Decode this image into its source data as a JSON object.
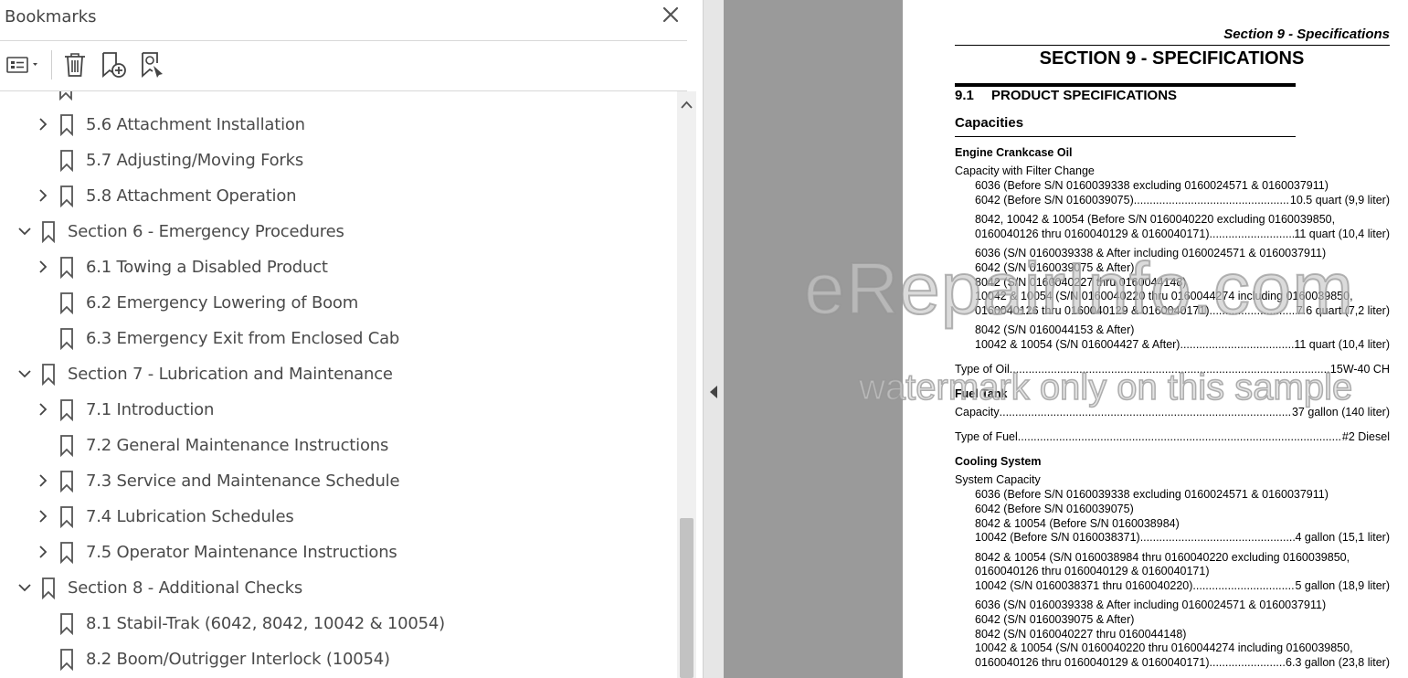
{
  "panel": {
    "title": "Bookmarks",
    "close_icon": "close-icon",
    "toolbar": [
      "options-menu-icon",
      "delete-bookmark-icon",
      "new-bookmark-icon",
      "find-current-bookmark-icon"
    ]
  },
  "bookmarks": [
    {
      "level": 1,
      "label": "5.6 Attachment Installation",
      "expandable": true
    },
    {
      "level": 1,
      "label": "5.7 Adjusting/Moving Forks",
      "expandable": false
    },
    {
      "level": 1,
      "label": "5.8 Attachment Operation",
      "expandable": true
    },
    {
      "level": 0,
      "label": "Section 6 - Emergency Procedures",
      "expandable": true,
      "expanded": true
    },
    {
      "level": 1,
      "label": "6.1 Towing a Disabled Product",
      "expandable": true
    },
    {
      "level": 1,
      "label": "6.2 Emergency Lowering of Boom",
      "expandable": false
    },
    {
      "level": 1,
      "label": "6.3 Emergency Exit from Enclosed Cab",
      "expandable": false
    },
    {
      "level": 0,
      "label": "Section 7 - Lubrication and Maintenance",
      "expandable": true,
      "expanded": true
    },
    {
      "level": 1,
      "label": "7.1 Introduction",
      "expandable": true
    },
    {
      "level": 1,
      "label": "7.2 General Maintenance Instructions",
      "expandable": false
    },
    {
      "level": 1,
      "label": "7.3 Service and Maintenance Schedule",
      "expandable": true
    },
    {
      "level": 1,
      "label": "7.4 Lubrication Schedules",
      "expandable": true
    },
    {
      "level": 1,
      "label": "7.5 Operator Maintenance Instructions",
      "expandable": true
    },
    {
      "level": 0,
      "label": "Section 8 - Additional Checks",
      "expandable": true,
      "expanded": true
    },
    {
      "level": 1,
      "label": "8.1 Stabil-Trak (6042, 8042, 10042 & 10054)",
      "expandable": false
    },
    {
      "level": 1,
      "label": "8.2 Boom/Outrigger Interlock (10054)",
      "expandable": false
    }
  ],
  "page": {
    "header": "Section 9 - Specifications",
    "section_title": "SECTION 9 - SPECIFICATIONS",
    "sub_num": "9.1",
    "sub_title": "PRODUCT SPECIFICATIONS",
    "capacities": "Capacities",
    "engine_oil": "Engine Crankcase Oil",
    "cap_filter": "Capacity with Filter Change",
    "eo1a": "6036 (Before S/N 0160039338 excluding 0160024571 & 0160037911)",
    "eo1b": "6042 (Before S/N 0160039075)",
    "eo1b_val": "10.5 quart (9,9 liter)",
    "eo2a": "8042, 10042 & 10054 (Before S/N 0160040220 excluding 0160039850,",
    "eo2b": "0160040126 thru 0160040129 & 0160040171)",
    "eo2b_val": "11 quart (10,4 liter)",
    "eo3a": "6036 (S/N 0160039338 & After including 0160024571 & 0160037911)",
    "eo3b": "6042 (S/N 0160039075 & After)",
    "eo3c": "8042 (S/N 0160040227 thru 0160044148)",
    "eo3d": "10042  &  10054  (S/N  0160040220  thru  0160044274  including  0160039850,",
    "eo3e": "0160040126 thru 0160040129 & 0160040171)",
    "eo3e_val": "7.6 quart (7,2 liter)",
    "eo4a": "8042 (S/N 0160044153 & After)",
    "eo4b": "10042 & 10054 (S/N 016004427 & After)",
    "eo4b_val": "11 quart (10,4 liter)",
    "oil_type": "Type of Oil",
    "oil_type_val": "15W-40 CH",
    "fuel_tank": "Fuel Tank",
    "fuel_cap": "Capacity",
    "fuel_cap_val": "37 gallon (140 liter)",
    "fuel_type": "Type of Fuel",
    "fuel_type_val": "#2 Diesel",
    "cooling": "Cooling System",
    "sys_cap": "System Capacity",
    "cs1a": "6036 (Before S/N 0160039338 excluding 0160024571 & 0160037911)",
    "cs1b": "6042 (Before S/N 0160039075)",
    "cs1c": "8042 & 10054 (Before S/N 0160038984)",
    "cs1d": "10042 (Before S/N 0160038371)",
    "cs1d_val": "4 gallon (15,1 liter)",
    "cs2a": "8042 & 10054 (S/N 0160038984 thru 0160040220 excluding 0160039850,",
    "cs2b": "0160040126 thru 0160040129 & 0160040171)",
    "cs2c": "10042 (S/N 0160038371 thru 0160040220)",
    "cs2c_val": "5 gallon (18,9 liter)",
    "cs3a": "6036 (S/N 0160039338 & After including 0160024571 & 0160037911)",
    "cs3b": "6042 (S/N 0160039075 & After)",
    "cs3c": "8042 (S/N 0160040227 thru 0160044148)",
    "cs3d": "10042  &  10054  (S/N  0160040220  thru  0160044274  including  0160039850,",
    "cs3e": "0160040126 thru 0160040129 & 0160040171)",
    "cs3e_val": "6.3 gallon (23,8 liter)"
  },
  "watermark": {
    "line1": "eRepairInfo.com",
    "line2": "watermark only on this sample"
  }
}
